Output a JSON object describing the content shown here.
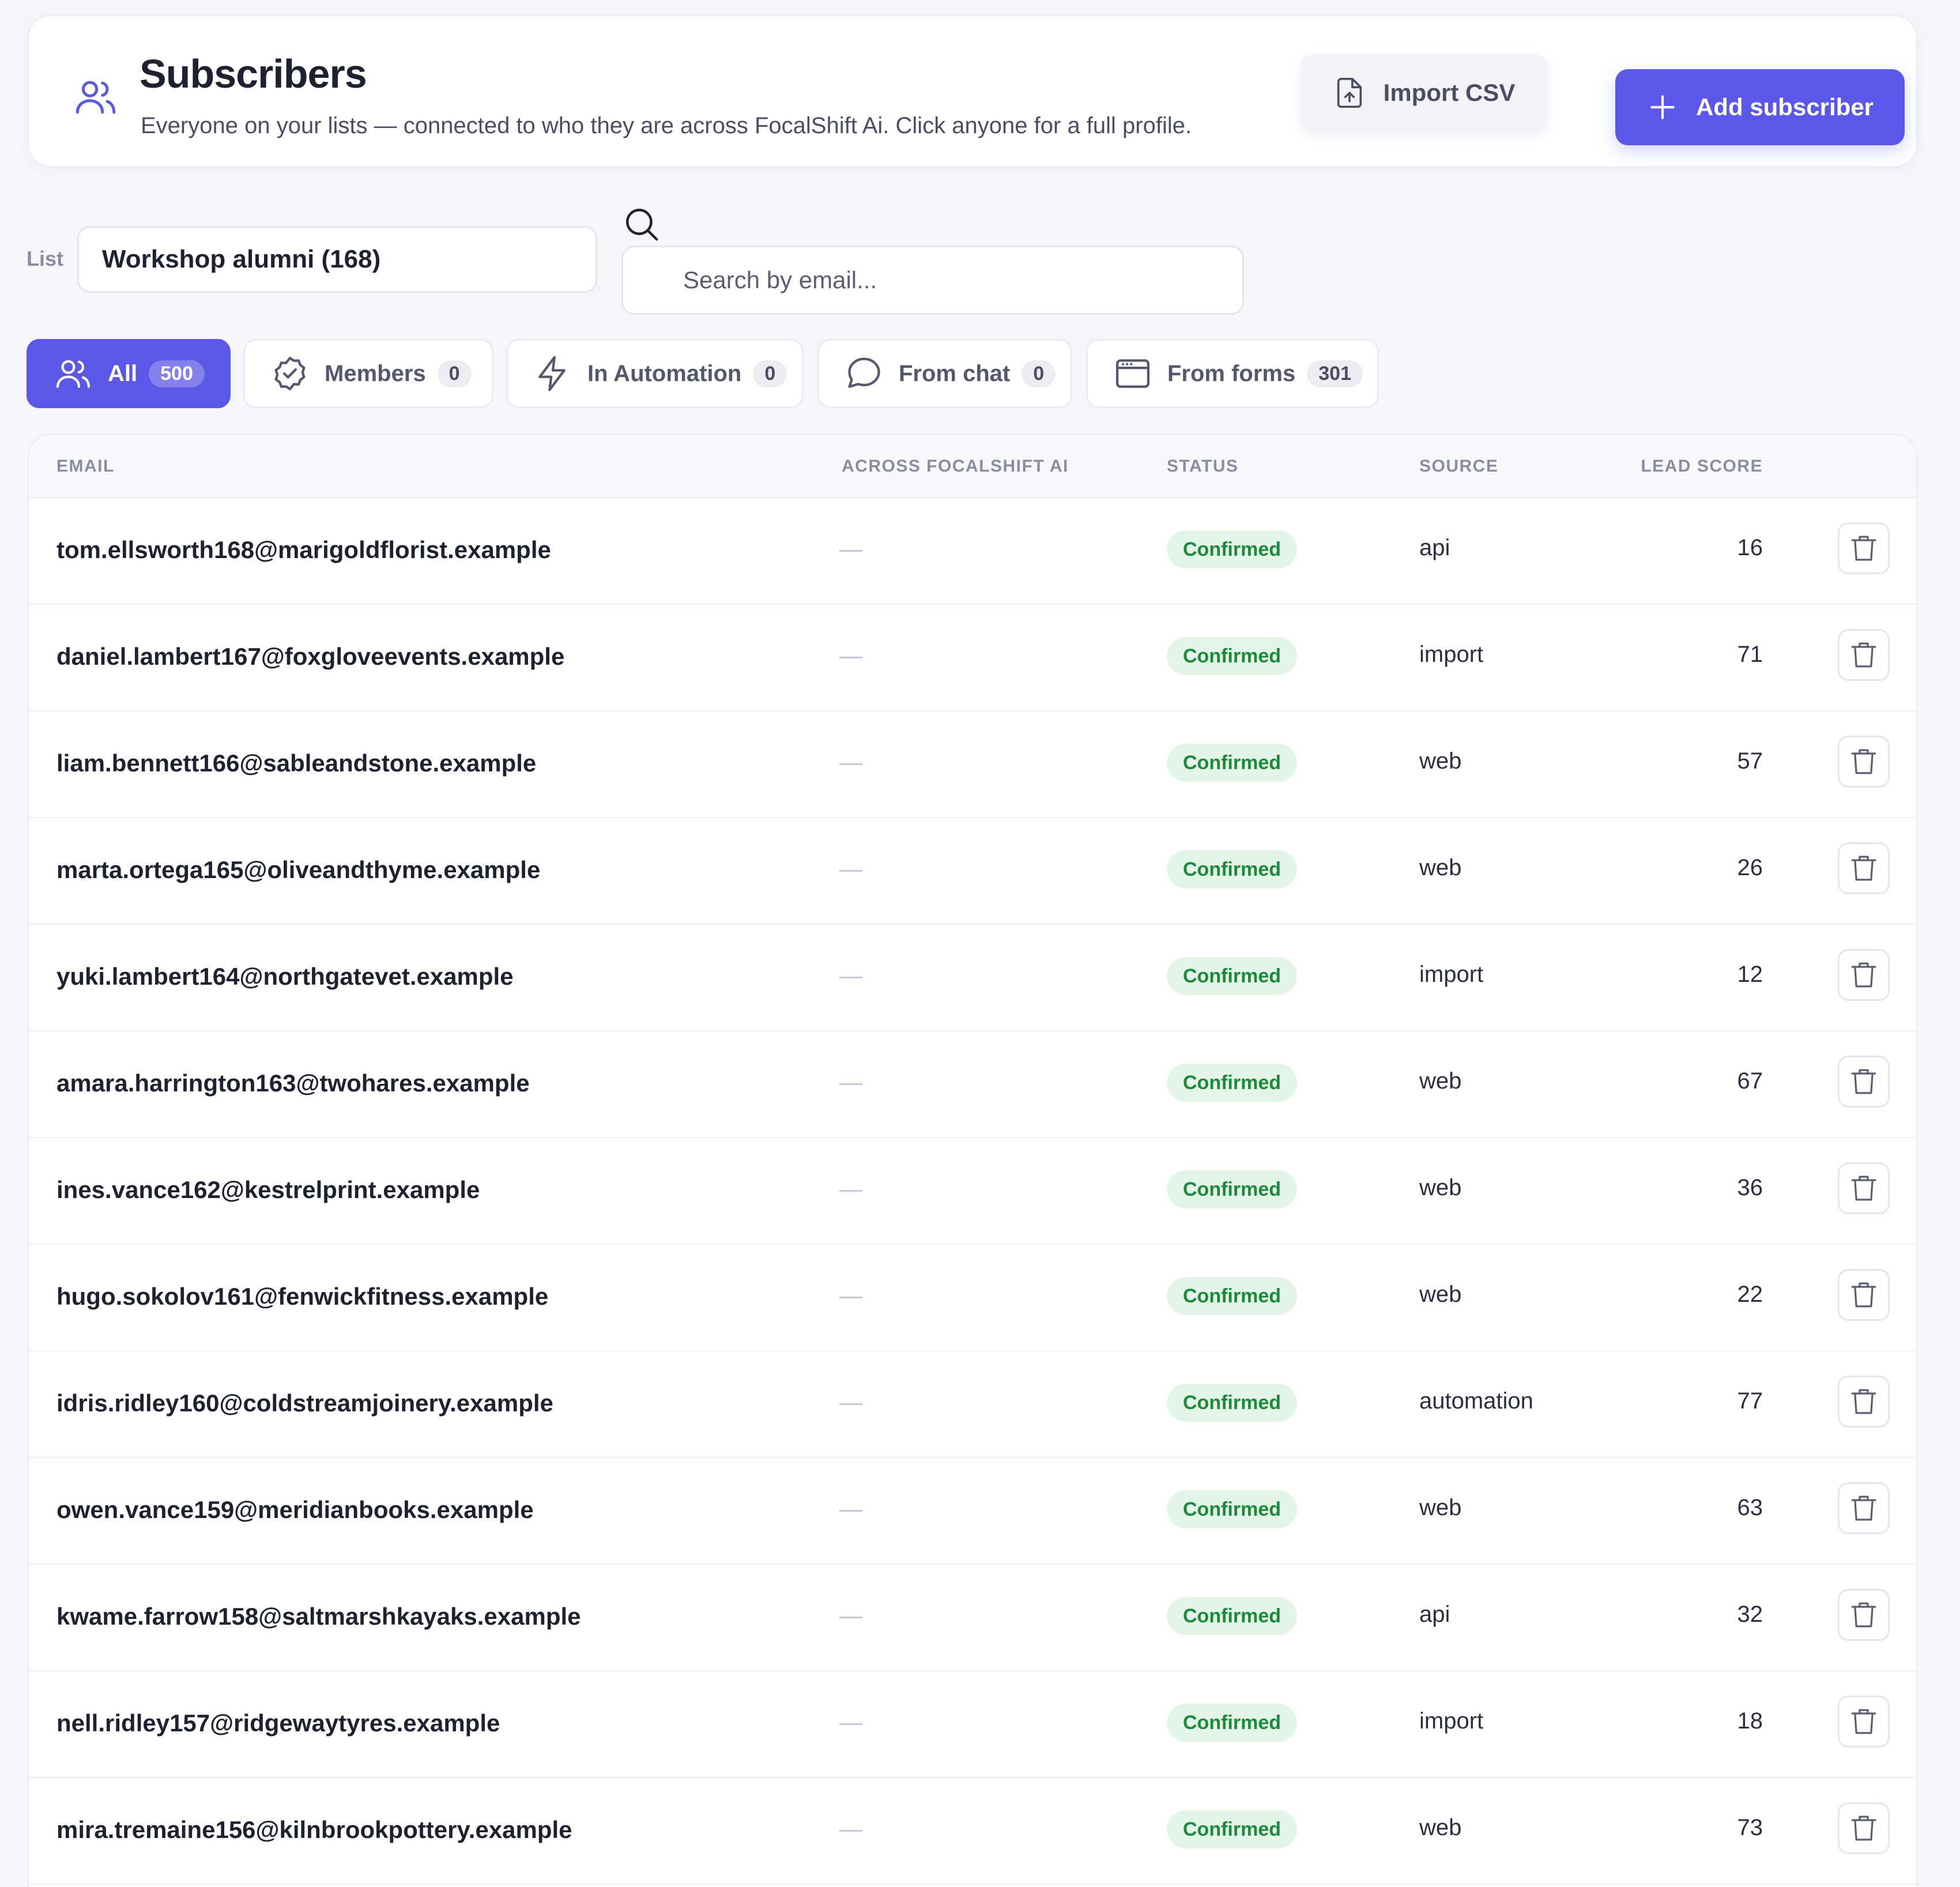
{
  "header": {
    "title": "Subscribers",
    "subtitle": "Everyone on your lists — connected to who they are across FocalShift Ai. Click anyone for a full profile.",
    "import_label": "Import CSV",
    "add_label": "Add subscriber",
    "header_icon": "users-icon",
    "import_icon": "file-upload-icon",
    "add_icon": "plus-icon"
  },
  "filters": {
    "list_label": "List",
    "list_value": "Workshop alumni (168)",
    "search_placeholder": "Search by email..."
  },
  "tabs": [
    {
      "label": "All",
      "count": "500",
      "icon": "users-icon",
      "active": true
    },
    {
      "label": "Members",
      "count": "0",
      "icon": "verified-badge-icon",
      "active": false
    },
    {
      "label": "In Automation",
      "count": "0",
      "icon": "lightning-icon",
      "active": false
    },
    {
      "label": "From chat",
      "count": "0",
      "icon": "chat-bubble-icon",
      "active": false
    },
    {
      "label": "From forms",
      "count": "301",
      "icon": "browser-window-icon",
      "active": false
    }
  ],
  "table": {
    "columns": [
      "EMAIL",
      "ACROSS FOCALSHIFT AI",
      "STATUS",
      "SOURCE",
      "LEAD SCORE"
    ],
    "rows": [
      {
        "email": "tom.ellsworth168@marigoldflorist.example",
        "status": "Confirmed",
        "source": "api",
        "score": "16"
      },
      {
        "email": "daniel.lambert167@foxgloveevents.example",
        "status": "Confirmed",
        "source": "import",
        "score": "71"
      },
      {
        "email": "liam.bennett166@sableandstone.example",
        "status": "Confirmed",
        "source": "web",
        "score": "57"
      },
      {
        "email": "marta.ortega165@oliveandthyme.example",
        "status": "Confirmed",
        "source": "web",
        "score": "26"
      },
      {
        "email": "yuki.lambert164@northgatevet.example",
        "status": "Confirmed",
        "source": "import",
        "score": "12"
      },
      {
        "email": "amara.harrington163@twohares.example",
        "status": "Confirmed",
        "source": "web",
        "score": "67"
      },
      {
        "email": "ines.vance162@kestrelprint.example",
        "status": "Confirmed",
        "source": "web",
        "score": "36"
      },
      {
        "email": "hugo.sokolov161@fenwickfitness.example",
        "status": "Confirmed",
        "source": "web",
        "score": "22"
      },
      {
        "email": "idris.ridley160@coldstreamjoinery.example",
        "status": "Confirmed",
        "source": "automation",
        "score": "77"
      },
      {
        "email": "owen.vance159@meridianbooks.example",
        "status": "Confirmed",
        "source": "web",
        "score": "63"
      },
      {
        "email": "kwame.farrow158@saltmarshkayaks.example",
        "status": "Confirmed",
        "source": "api",
        "score": "32"
      },
      {
        "email": "nell.ridley157@ridgewaytyres.example",
        "status": "Confirmed",
        "source": "import",
        "score": "18"
      },
      {
        "email": "mira.tremaine156@kilnbrookpottery.example",
        "status": "Confirmed",
        "source": "web",
        "score": "73"
      }
    ]
  },
  "colors": {
    "accent": "#5b57e7",
    "confirmed_bg": "#e3f5e7",
    "confirmed_text": "#1b8a3b"
  }
}
